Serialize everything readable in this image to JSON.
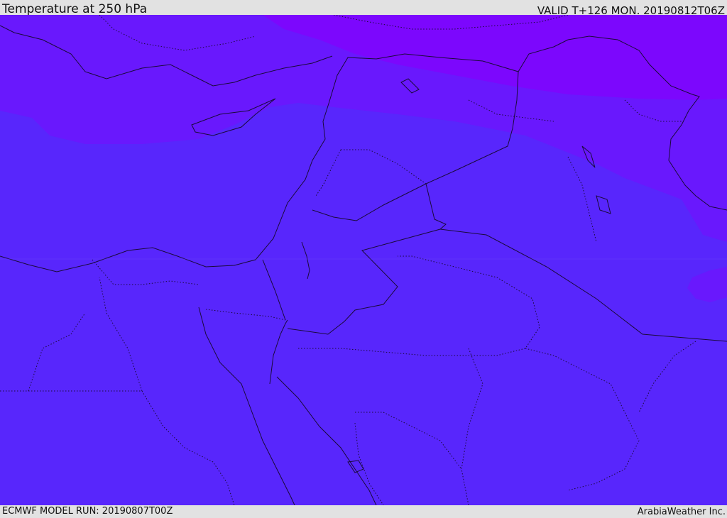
{
  "header": {
    "title": "Temperature at 250 hPa",
    "valid_time": "VALID T+126 MON. 20190812T06Z"
  },
  "footer": {
    "model_run": "ECMWF MODEL RUN: 20190807T00Z",
    "credit": "ArabiaWeather Inc."
  },
  "map": {
    "colors": {
      "base_fill": "#5826fc",
      "mid_band": "#6918fd",
      "top_band": "#7c07fd",
      "border_line": "#1a0a3a",
      "map_edge": "#3d18b0"
    }
  }
}
